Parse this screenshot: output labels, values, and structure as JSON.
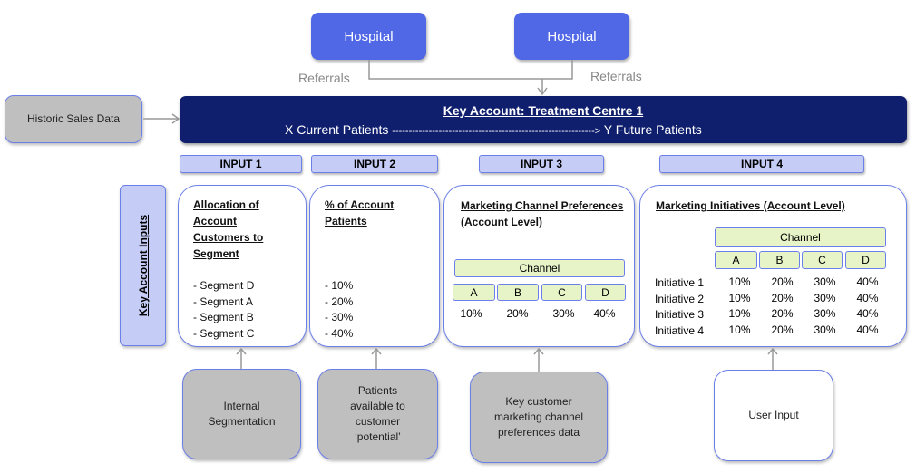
{
  "hospitals": [
    "Hospital",
    "Hospital"
  ],
  "referrals": [
    "Referrals",
    "Referrals"
  ],
  "historic": "Historic Sales Data",
  "banner": {
    "title": "Key Account: Treatment Centre 1",
    "current": "X Current Patients",
    "arrow": "------------------------------------------------------------->",
    "future": "Y Future Patients"
  },
  "inputs": [
    "INPUT 1",
    "INPUT 2",
    "INPUT 3",
    "INPUT 4"
  ],
  "side_label": "Key Account Inputs",
  "card1": {
    "title": "Allocation of Account Customers to Segment",
    "items": [
      "- Segment D",
      "- Segment A",
      "- Segment B",
      "- Segment C"
    ]
  },
  "card2": {
    "title": "% of  Account Patients",
    "items": [
      "- 10%",
      "- 20%",
      "- 30%",
      "- 40%"
    ]
  },
  "card3": {
    "title": "Marketing Channel Preferences (Account Level)",
    "channel": "Channel",
    "cols": [
      "A",
      "B",
      "C",
      "D"
    ],
    "values": [
      "10%",
      "20%",
      "30%",
      "40%"
    ]
  },
  "card4": {
    "title": "Marketing Initiatives (Account Level)",
    "channel": "Channel",
    "cols": [
      "A",
      "B",
      "C",
      "D"
    ],
    "rows": [
      {
        "label": "Initiative 1",
        "values": [
          "10%",
          "20%",
          "30%",
          "40%"
        ]
      },
      {
        "label": "Initiative 2",
        "values": [
          "10%",
          "20%",
          "30%",
          "40%"
        ]
      },
      {
        "label": "Initiative 3",
        "values": [
          "10%",
          "20%",
          "30%",
          "40%"
        ]
      },
      {
        "label": "Initiative 4",
        "values": [
          "10%",
          "20%",
          "30%",
          "40%"
        ]
      }
    ]
  },
  "sources": [
    "Internal Segmentation",
    "Patients available to customer ‘potential’",
    "Key customer marketing channel preferences data",
    "User Input"
  ],
  "colors": {
    "hospital": "#5068E6",
    "banner": "#0F1F6E",
    "input_tab": "#C5CCF5",
    "source_gray": "#BFBFBF",
    "channel_cell": "#E6F4C8"
  }
}
